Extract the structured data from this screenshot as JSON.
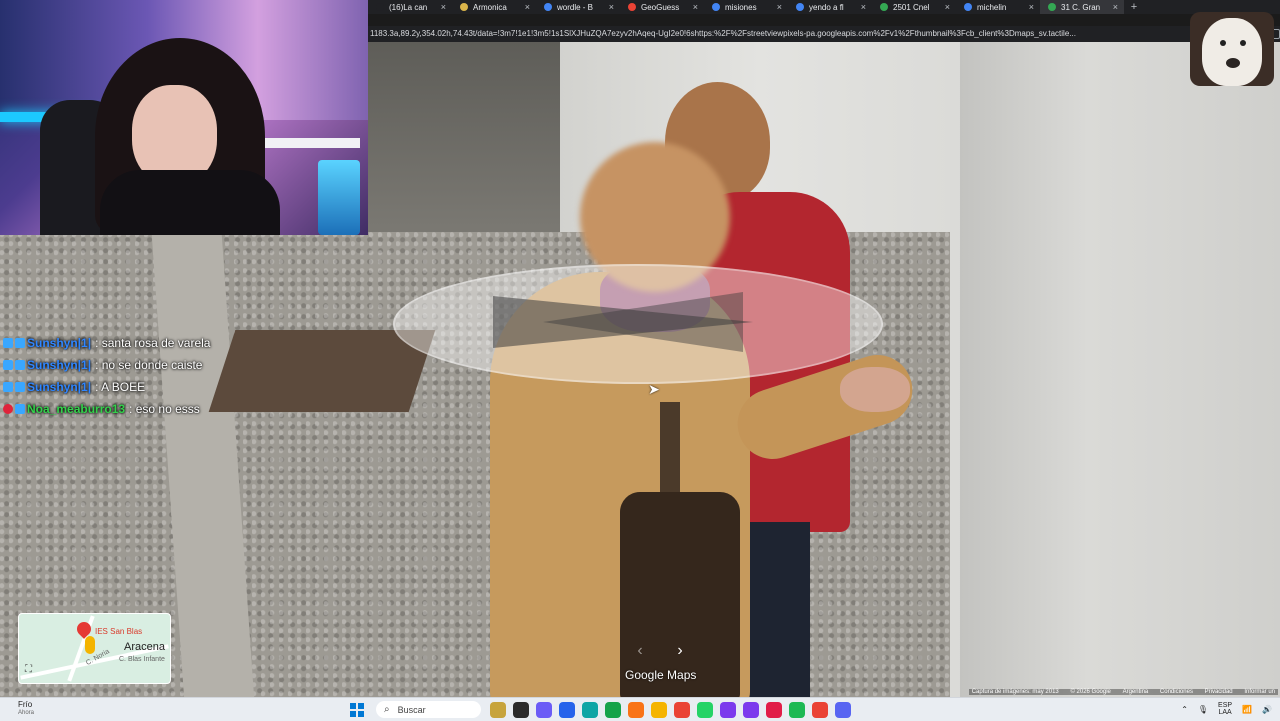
{
  "browser": {
    "tabs": [
      {
        "title": "(16)La can",
        "color": "#202124"
      },
      {
        "title": "Armonica",
        "color": "#d9b44a"
      },
      {
        "title": "wordle - B",
        "color": "#4285f4"
      },
      {
        "title": "GeoGuess",
        "color": "#ea4335"
      },
      {
        "title": "misiones",
        "color": "#4285f4"
      },
      {
        "title": "yendo a fl",
        "color": "#4285f4"
      },
      {
        "title": "2501 Cnel",
        "color": "#34a853"
      },
      {
        "title": "michelin",
        "color": "#4285f4"
      },
      {
        "title": "31 C. Gran",
        "color": "#34a853"
      }
    ],
    "new_tab": "+",
    "url": "1183.3a,89.2y,354.02h,74.43t/data=!3m7!1e1!3m5!1s1SlXJHuZQA7ezyv2hAqeq-UgI2e0!6shttps:%2F%2Fstreetviewpixels-pa.googleapis.com%2Fv1%2Fthumbnail%3Fcb_client%3Dmaps_sv.tactile..."
  },
  "chat": [
    {
      "user": "Sunshyn|1|",
      "text": ": santa rosa de varela",
      "color": "blue",
      "badge": "blue"
    },
    {
      "user": "Sunshyn|1|",
      "text": ": no se donde caiste",
      "color": "blue",
      "badge": "blue"
    },
    {
      "user": "Sunshyn|1|",
      "text": ": A BOEE",
      "color": "blue",
      "badge": "blue"
    },
    {
      "user": "Noa_meaburro13",
      "text": ": eso no esss",
      "color": "green",
      "badge": "heart"
    }
  ],
  "minimap": {
    "label_school": "IES San Blas",
    "label_town": "Aracena",
    "label_street1": "C. Noria",
    "label_street2": "C. Blas Infante"
  },
  "streetview": {
    "brand": "Google Maps",
    "prev": "‹",
    "next": "›",
    "attribution": {
      "capture": "Captura de imágenes: may 2013",
      "copyright": "© 2026 Google",
      "country": "Argentina",
      "terms": "Condiciones",
      "privacy": "Privacidad",
      "report": "Informar un"
    }
  },
  "taskbar": {
    "weather_title": "Frío",
    "weather_sub": "Ahora",
    "search_placeholder": "Buscar",
    "lang": "ESP",
    "lang_sub": "LAA",
    "icon_colors": [
      "#c7a43c",
      "#2b2b2b",
      "#6b5cf6",
      "#2563eb",
      "#0ea5a5",
      "#16a34a",
      "#f97316",
      "#f5b400",
      "#ea4335",
      "#25d366",
      "#7c3aed",
      "#7c3aed",
      "#e11d48",
      "#1db954",
      "#ea4335",
      "#5865f2"
    ]
  }
}
